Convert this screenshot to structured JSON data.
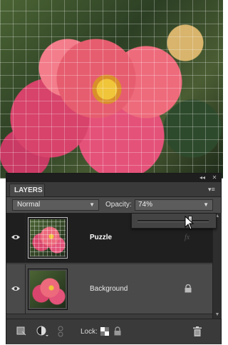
{
  "panel": {
    "tab_label": "LAYERS",
    "blend_mode": "Normal",
    "opacity_label": "Opacity:",
    "opacity_value": "74%",
    "opacity_fraction": 0.74
  },
  "layers": [
    {
      "name": "Puzzle",
      "selected": true,
      "visible": true,
      "badge_icon": "fx-icon"
    },
    {
      "name": "Background",
      "selected": false,
      "visible": true,
      "badge_icon": "lock-icon"
    }
  ],
  "bottom_bar": {
    "lock_label": "Lock:"
  },
  "colors": {
    "panel_bg": "#2b2b2b",
    "selected_row": "#1f1f1f",
    "row_bg": "#4a4a4a"
  }
}
